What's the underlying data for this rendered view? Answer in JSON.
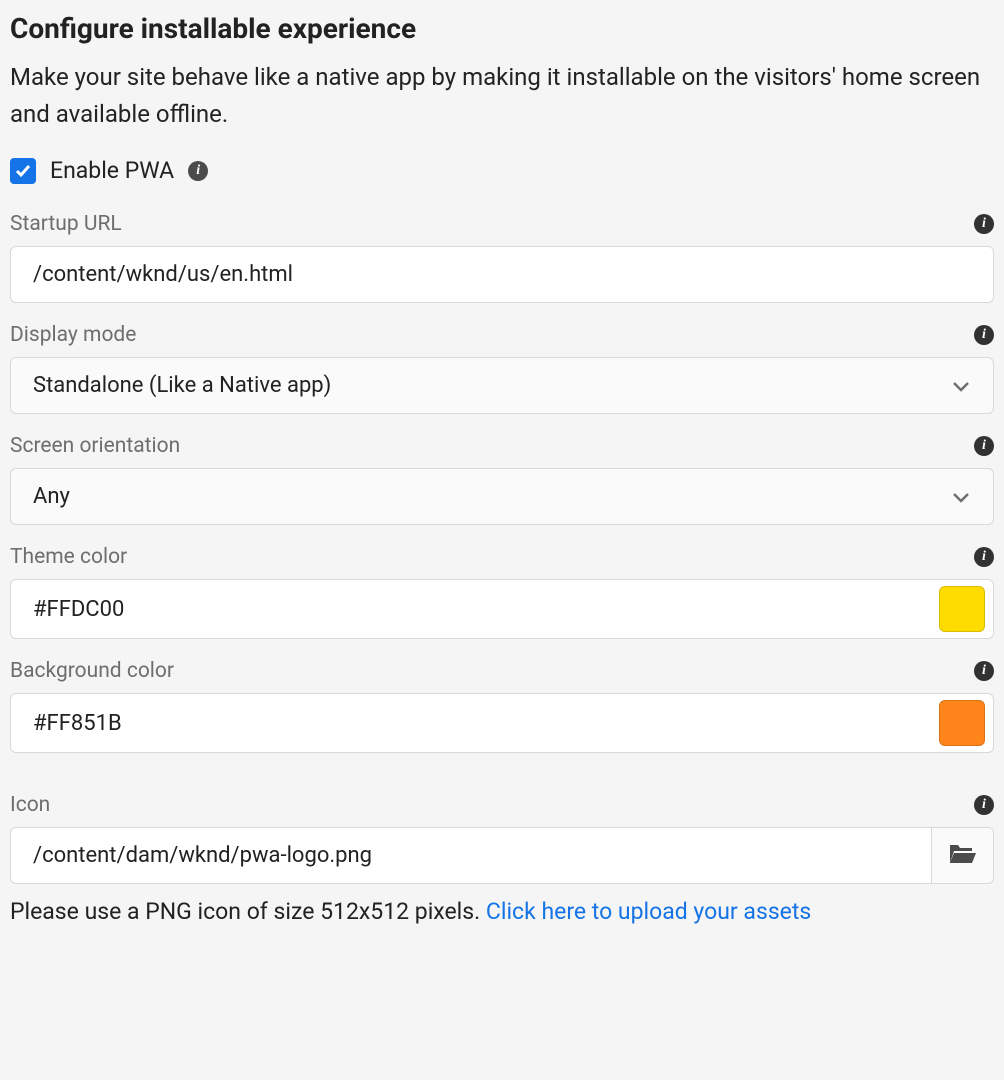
{
  "header": {
    "title": "Configure installable experience",
    "description": "Make your site behave like a native app by making it installable on the visitors' home screen and available offline."
  },
  "enable": {
    "label": "Enable PWA",
    "checked": true
  },
  "fields": {
    "startup_url": {
      "label": "Startup URL",
      "value": "/content/wknd/us/en.html"
    },
    "display_mode": {
      "label": "Display mode",
      "value": "Standalone (Like a Native app)"
    },
    "screen_orientation": {
      "label": "Screen orientation",
      "value": "Any"
    },
    "theme_color": {
      "label": "Theme color",
      "value": "#FFDC00",
      "swatch": "#FFDC00"
    },
    "background_color": {
      "label": "Background color",
      "value": "#FF851B",
      "swatch": "#FF851B"
    },
    "icon": {
      "label": "Icon",
      "value": "/content/dam/wknd/pwa-logo.png",
      "hint_prefix": "Please use a PNG icon of size 512x512 pixels. ",
      "hint_link": "Click here to upload your assets"
    }
  }
}
